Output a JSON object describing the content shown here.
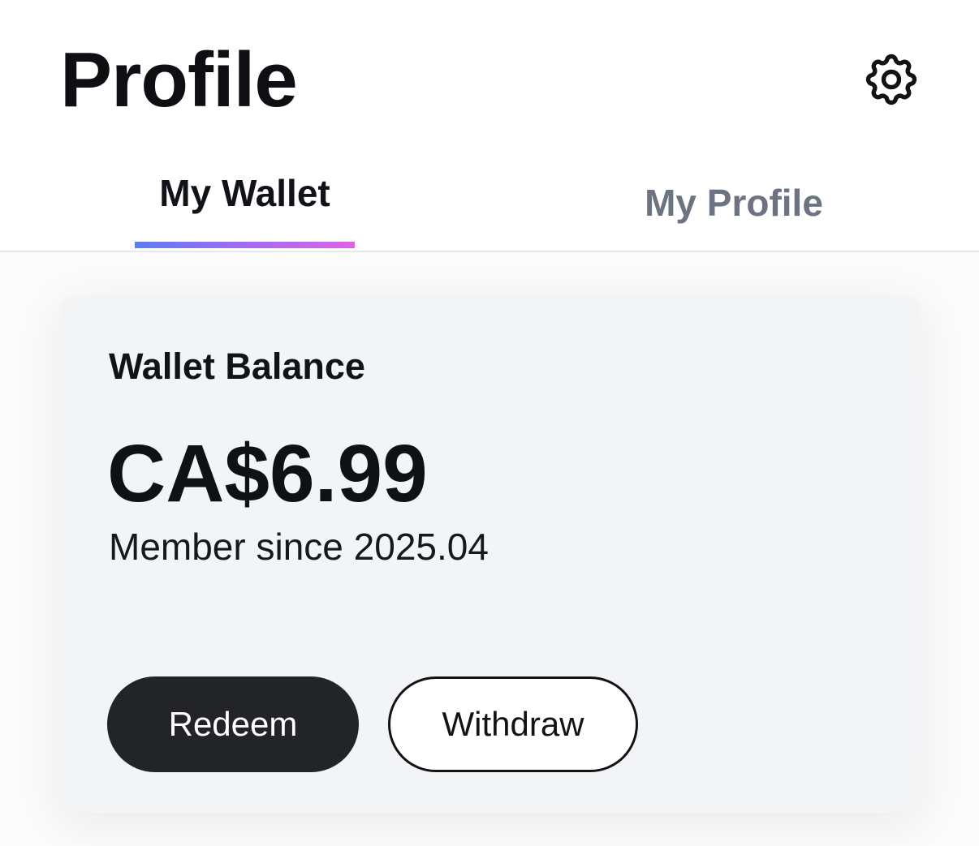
{
  "header": {
    "title": "Profile",
    "settings_icon": "gear-icon"
  },
  "tabs": [
    {
      "label": "My Wallet",
      "active": true
    },
    {
      "label": "My Profile",
      "active": false
    }
  ],
  "wallet": {
    "title": "Wallet Balance",
    "balance": "CA$6.99",
    "member_since": "Member since 2025.04",
    "redeem_label": "Redeem",
    "withdraw_label": "Withdraw"
  },
  "colors": {
    "tab_underline_start": "#5e7cf2",
    "tab_underline_end": "#df62e6",
    "primary_button": "#222427",
    "inactive_tab": "#6b7480",
    "card_background": "#f2f4f6"
  }
}
